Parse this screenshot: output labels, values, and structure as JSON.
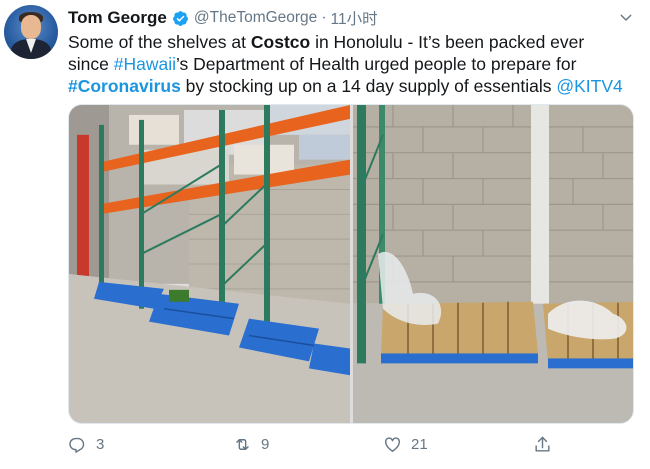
{
  "author": {
    "name": "Tom George",
    "handle": "@TheTomGeorge",
    "separator": "·",
    "time": "11小时"
  },
  "tweet": {
    "l1a": "Some of the shelves at ",
    "l1b": "Costco",
    "l1c": " in Honolulu - It’s been packed ever",
    "l2a": "since ",
    "l2b": "#Hawaii",
    "l2c": "’s Department of Health urged people to prepare for",
    "l3a": "#Coronavirus",
    "l3b": " by stocking up on a 14 day supply of essentials ",
    "l3c": "@KITV4"
  },
  "actions": {
    "reply_count": "3",
    "retweet_count": "9",
    "like_count": "21"
  },
  "icons": {
    "avatar": "avatar",
    "verified": "verified-badge-icon",
    "menu": "chevron-down-icon",
    "reply": "reply-icon",
    "retweet": "retweet-icon",
    "like": "heart-icon",
    "share": "share-icon"
  },
  "colors": {
    "link": "#1b95e0",
    "muted": "#657786",
    "rack_orange": "#e8641e",
    "rack_green": "#2e7a5e",
    "pallet_blue": "#2a6fd0"
  }
}
